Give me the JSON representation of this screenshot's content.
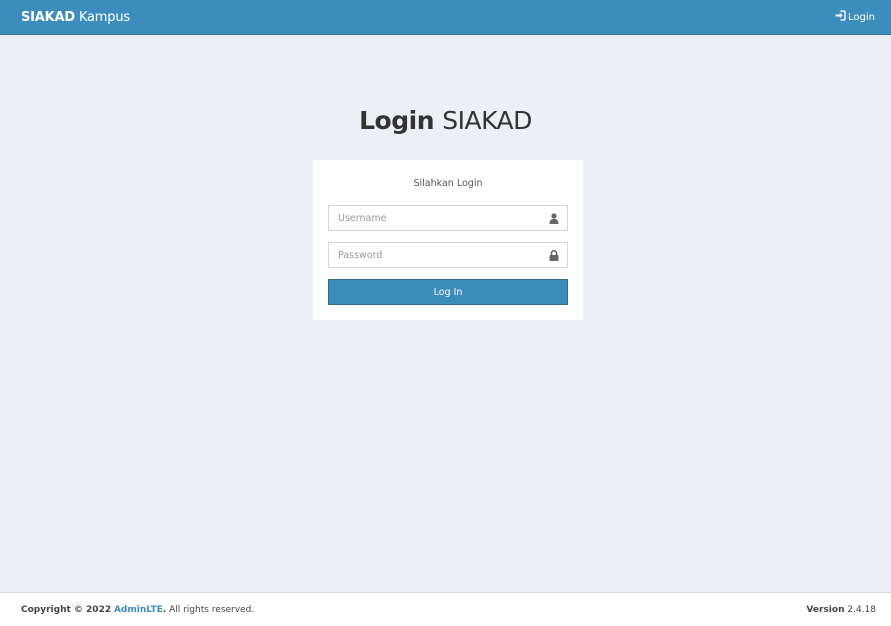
{
  "navbar": {
    "brand_bold": "SIAKAD",
    "brand_light": "Kampus",
    "login_label": "Login",
    "login_icon": "sign-in-icon",
    "bg_color": "#3c8dbc"
  },
  "page": {
    "title_bold": "Login",
    "title_light": "SIAKAD",
    "bg_color": "#ecf0f5"
  },
  "login_box": {
    "message": "Silahkan Login",
    "username": {
      "placeholder": "Username",
      "value": "",
      "icon": "user-icon"
    },
    "password": {
      "placeholder": "Password",
      "value": "",
      "icon": "lock-icon"
    },
    "submit_label": "Log In",
    "submit_color": "#3c8dbc"
  },
  "footer": {
    "copyright_prefix": "Copyright © 2022",
    "brand_link": "AdminLTE",
    "suffix": ". All rights reserved.",
    "version_label": "Version",
    "version_number": "2.4.18"
  }
}
